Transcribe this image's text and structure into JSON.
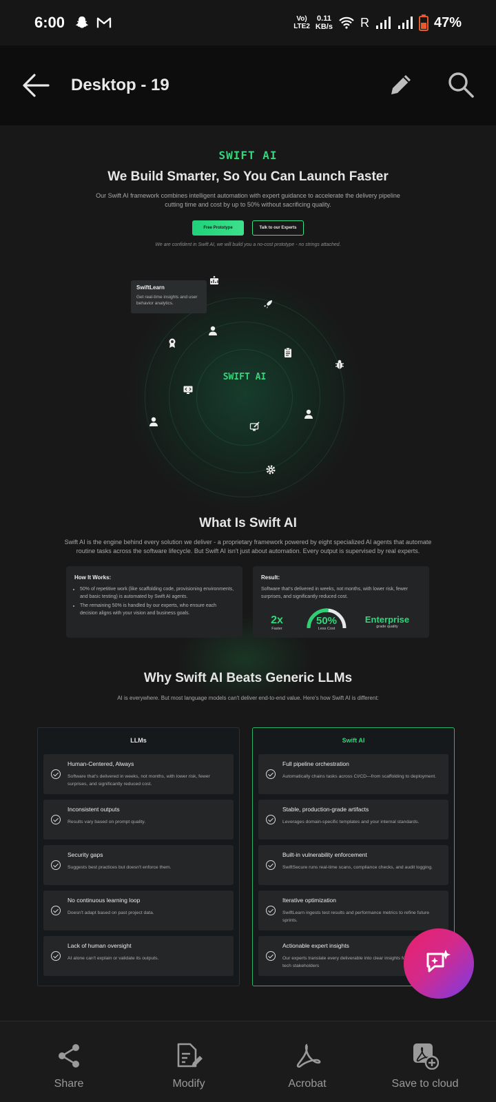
{
  "status_bar": {
    "time": "6:00",
    "volte_line1": "Vo)",
    "volte_line2": "LTE2",
    "netspeed_value": "0.11",
    "netspeed_unit": "KB/s",
    "roaming": "R",
    "battery": "47%"
  },
  "app_bar": {
    "title": "Desktop - 19"
  },
  "doc": {
    "hero": {
      "brand": "SWIFT AI",
      "headline": "We Build Smarter, So You Can Launch Faster",
      "sub_line1": "Our Swift AI framework combines intelligent automation with expert guidance to accelerate the delivery pipeline",
      "sub_line2": "cutting time and cost by up to 50% without sacrificing quality.",
      "btn_primary": "Free Prototype",
      "btn_secondary": "Talk to our Experts",
      "tagline": "We are confident in Swift AI, we will build you a no-cost prototype - no strings attached."
    },
    "orbit": {
      "tooltip_title": "SwiftLearn",
      "tooltip_text": "Get real-time insights and user behavior analytics.",
      "center_brand": "SWIFT AI"
    },
    "what": {
      "title": "What Is Swift AI",
      "line1": "Swift AI is the engine behind every solution we deliver - a proprietary framework powered by eight specialized AI agents that automate",
      "line2": "routine tasks across the software lifecycle.  But Swift AI isn't just about automation. Every output is supervised by real experts.",
      "how_title": "How It Works:",
      "how_items": [
        "50% of repetitive work (like scaffolding code, provisioning environments, and basic testing) is automated by Swift AI agents.",
        "The remaining 50% is handled by our experts, who ensure each decision aligns with your vision and business goals."
      ],
      "result_title": "Result:",
      "result_text": "Software that's delivered in weeks, not months, with lower risk, fewer surprises, and significantly reduced cost.",
      "stats": [
        {
          "value": "2x",
          "label": "Faster"
        },
        {
          "value": "50%",
          "label": "Less Cost"
        },
        {
          "value": "Enterprise",
          "label": "grade quality"
        }
      ]
    },
    "why": {
      "title": "Why Swift AI Beats Generic LLMs",
      "subtitle": "AI is everywhere. But most language models can't deliver end-to-end value. Here's how Swift AI is different:",
      "llm_head": "LLMs",
      "swift_head": "Swift AI",
      "llm_items": [
        {
          "title": "Human-Centered, Always",
          "text": "Software that's delivered in weeks, not months, with lower risk, fewer surprises, and significantly reduced cost."
        },
        {
          "title": "Inconsistent outputs",
          "text": "Results vary based on prompt quality."
        },
        {
          "title": "Security gaps",
          "text": "Suggests best practices but doesn't enforce them."
        },
        {
          "title": "No continuous learning loop",
          "text": "Doesn't adapt based on past project data."
        },
        {
          "title": "Lack of human oversight",
          "text": "AI alone can't explain or validate its outputs."
        }
      ],
      "swift_items": [
        {
          "title": "Full pipeline orchestration",
          "text": "Automatically chains tasks across CI/CD—from scaffolding to deployment."
        },
        {
          "title": "Stable, production-grade artifacts",
          "text": "Leverages domain-specific templates and your internal standards."
        },
        {
          "title": "Built-in vulnerability enforcement",
          "text": "SwiftSecure runs real-time scans, compliance checks, and audit logging."
        },
        {
          "title": "Iterative optimization",
          "text": "SwiftLearn ingests test results and performance metrics to refine future sprints."
        },
        {
          "title": "Actionable expert insights",
          "text": "Our experts translate every deliverable into clear insights for business and tech stakeholders"
        }
      ]
    }
  },
  "bottom_bar": {
    "share": "Share",
    "modify": "Modify",
    "acrobat": "Acrobat",
    "save": "Save to cloud"
  },
  "colors": {
    "accent_green": "#33d67a",
    "fab_pink": "#e8206a",
    "fab_purple": "#7a3be6"
  }
}
